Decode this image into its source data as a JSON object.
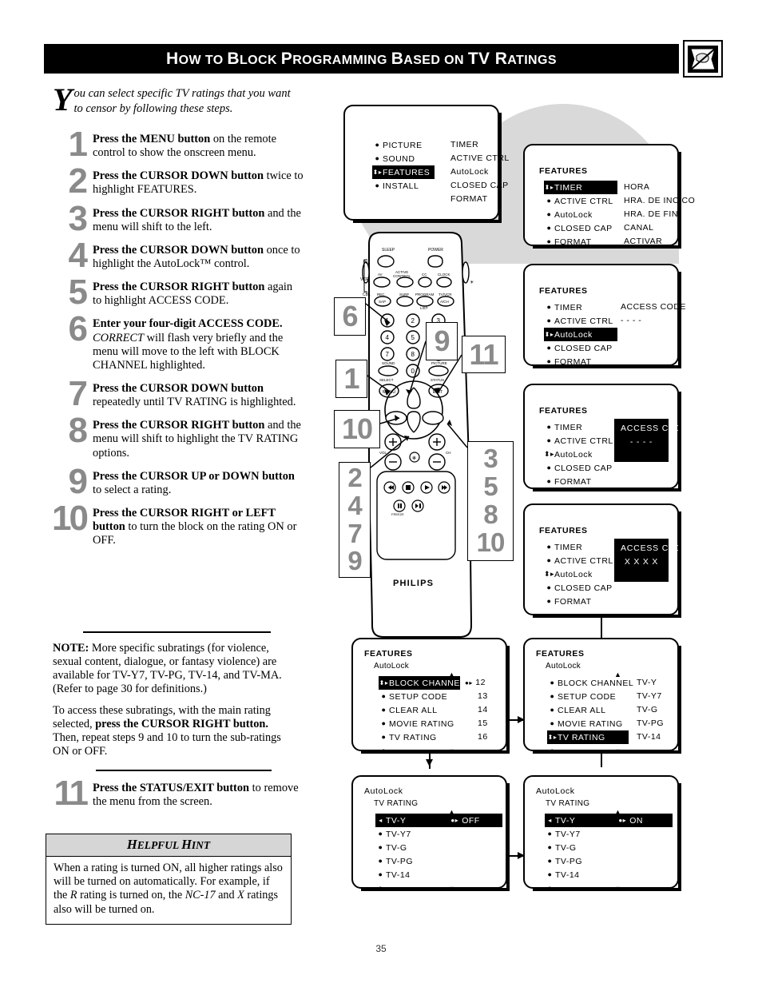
{
  "header": {
    "title_parts": [
      "H",
      "OW TO ",
      "B",
      "LOCK ",
      "P",
      "ROGRAMMING ",
      "B",
      "ASED ON ",
      "TV R",
      "ATINGS"
    ],
    "title": "How to Block Programming Based on TV Ratings",
    "logo_icon": "tv-no-signal-icon"
  },
  "intro": {
    "dropcap": "Y",
    "text": "ou can select specific TV ratings that you want to censor by following these steps."
  },
  "steps": [
    {
      "num": "1",
      "html": "<b>Press the MENU button</b> on the remote control to show the onscreen menu."
    },
    {
      "num": "2",
      "html": "<b>Press the CURSOR DOWN button</b> twice to highlight FEATURES."
    },
    {
      "num": "3",
      "html": "<b>Press the CURSOR RIGHT button</b> and the menu will shift to the left."
    },
    {
      "num": "4",
      "html": "<b>Press the CURSOR DOWN button</b> once to highlight the AutoLock&trade; control."
    },
    {
      "num": "5",
      "html": "<b>Press the CURSOR RIGHT button</b> again to highlight ACCESS CODE."
    },
    {
      "num": "6",
      "html": "<b>Enter your four-digit ACCESS CODE.</b> <i>CORRECT</i> will flash very briefly and the menu will move to the left with BLOCK CHANNEL highlighted."
    },
    {
      "num": "7",
      "html": "<b>Press the CURSOR DOWN button</b> repeatedly until TV RATING is highlighted."
    },
    {
      "num": "8",
      "html": "<b>Press the CURSOR RIGHT button</b> and the menu will shift to highlight the TV RATING options."
    },
    {
      "num": "9",
      "html": "<b>Press the CURSOR UP or DOWN button</b> to select a rating."
    },
    {
      "num": "10",
      "html": "<b>Press the CURSOR RIGHT or LEFT button</b> to turn the block on the rating ON or OFF."
    }
  ],
  "note": {
    "p1": "<b>NOTE:</b> More specific subratings (for violence, sexual content, dialogue, or fantasy violence) are available for TV-Y7, TV-PG, TV-14, and TV-MA. (Refer to page 30 for definitions.)",
    "p2": "To access these subratings, with the main rating selected, <b>press the CURSOR RIGHT button.</b> Then, repeat steps 9 and 10 to turn the sub-ratings ON or OFF."
  },
  "step11": {
    "num": "11",
    "html": "<b>Press the STATUS/EXIT button</b> to remove the menu from the screen."
  },
  "hint": {
    "heading_parts": [
      "H",
      "ELPFUL ",
      "H",
      "INT"
    ],
    "heading": "Helpful Hint",
    "body": "When a rating is turned ON, all higher ratings also will be turned on automatically.  For example, if the <i>R</i> rating is turned on, the <i>NC-17</i> and <i>X</i> ratings also will be turned on."
  },
  "page_number": "35",
  "remote": {
    "brand": "PHILIPS",
    "buttons": {
      "sleep": "SLEEP",
      "power": "POWER",
      "tv": "TV",
      "vcr": "VCR",
      "cbl": "CBL",
      "av": "AV",
      "active_control": "ACTIVE CONTROL",
      "cc": "CC",
      "clock": "CLOCK",
      "rec": "REC.",
      "sap": "SAP",
      "surf": "SURF",
      "program": "PROGRAM",
      "list": "LIST",
      "tvvcr": "TV/VCR",
      "ach": "A/CH",
      "sound": "SOUND",
      "picture": "PICTURE",
      "select": "SELECT",
      "menu": "MENU",
      "exit": "EXIT",
      "status": "STATUS",
      "vol": "VOL",
      "ch": "CH",
      "mute": "MUTE",
      "freeze": "FREEZE"
    },
    "keypad": [
      "1",
      "2",
      "3",
      "4",
      "5",
      "6",
      "7",
      "8",
      "9",
      "0"
    ],
    "callouts": [
      {
        "id": "c6",
        "label": "6"
      },
      {
        "id": "c9",
        "label": "9"
      },
      {
        "id": "c11",
        "label": "11"
      },
      {
        "id": "c1",
        "label": "1"
      },
      {
        "id": "c10",
        "label": "10"
      },
      {
        "id": "c2479",
        "label": "2 4 7 9"
      },
      {
        "id": "c35810",
        "label": "3 5 8 10"
      }
    ]
  },
  "osd": {
    "main_menu": {
      "left_items": [
        "PICTURE",
        "SOUND",
        "FEATURES",
        "INSTALL"
      ],
      "highlighted": "FEATURES",
      "right_items": [
        "TIMER",
        "ACTIVE CTRL",
        "AutoLock",
        "CLOSED CAP",
        "FORMAT"
      ]
    },
    "features_timer": {
      "title": "FEATURES",
      "items": [
        "TIMER",
        "ACTIVE CTRL",
        "AutoLock",
        "CLOSED CAP",
        "FORMAT"
      ],
      "highlighted": "TIMER",
      "values": [
        "HORA",
        "HRA. DE INCICO",
        "HRA. DE FIN",
        "CANAL",
        "ACTIVAR"
      ]
    },
    "features_autolock": {
      "title": "FEATURES",
      "items": [
        "TIMER",
        "ACTIVE CTRL",
        "AutoLock",
        "CLOSED CAP",
        "FORMAT"
      ],
      "highlighted": "AutoLock",
      "value_label": "ACCESS CODE",
      "value_digits": "- - - -"
    },
    "features_access_empty": {
      "title": "FEATURES",
      "items": [
        "TIMER",
        "ACTIVE CTRL",
        "AutoLock",
        "CLOSED CAP",
        "FORMAT"
      ],
      "highlighted": "AutoLock",
      "box_label": "ACCESS CODE",
      "box_digits": "- - - -"
    },
    "features_access_filled": {
      "title": "FEATURES",
      "items": [
        "TIMER",
        "ACTIVE CTRL",
        "AutoLock",
        "CLOSED CAP",
        "FORMAT"
      ],
      "highlighted": "AutoLock",
      "box_label": "ACCESS CODE",
      "box_digits": "X X X X"
    },
    "autolock_block_channel": {
      "title": "FEATURES",
      "subtitle": "AutoLock",
      "items": [
        "BLOCK CHANNEL",
        "SETUP CODE",
        "CLEAR ALL",
        "MOVIE RATING",
        "TV RATING",
        ""
      ],
      "highlighted": "BLOCK CHANNEL",
      "values": [
        "12",
        "13",
        "14",
        "15",
        "16"
      ]
    },
    "autolock_tv_rating": {
      "title": "FEATURES",
      "subtitle": "AutoLock",
      "items": [
        "BLOCK CHANNEL",
        "SETUP CODE",
        "CLEAR ALL",
        "MOVIE RATING",
        "TV RATING",
        ""
      ],
      "highlighted": "TV RATING",
      "values": [
        "TV-Y",
        "TV-Y7",
        "TV-G",
        "TV-PG",
        "TV-14"
      ]
    },
    "tv_rating_off": {
      "title": "AutoLock",
      "subtitle": "TV RATING",
      "items": [
        "TV-Y",
        "TV-Y7",
        "TV-G",
        "TV-PG",
        "TV-14",
        ""
      ],
      "highlighted": "TV-Y",
      "state": "OFF"
    },
    "tv_rating_on": {
      "title": "AutoLock",
      "subtitle": "TV RATING",
      "items": [
        "TV-Y",
        "TV-Y7",
        "TV-G",
        "TV-PG",
        "TV-14",
        ""
      ],
      "highlighted": "TV-Y",
      "state": "ON"
    }
  }
}
